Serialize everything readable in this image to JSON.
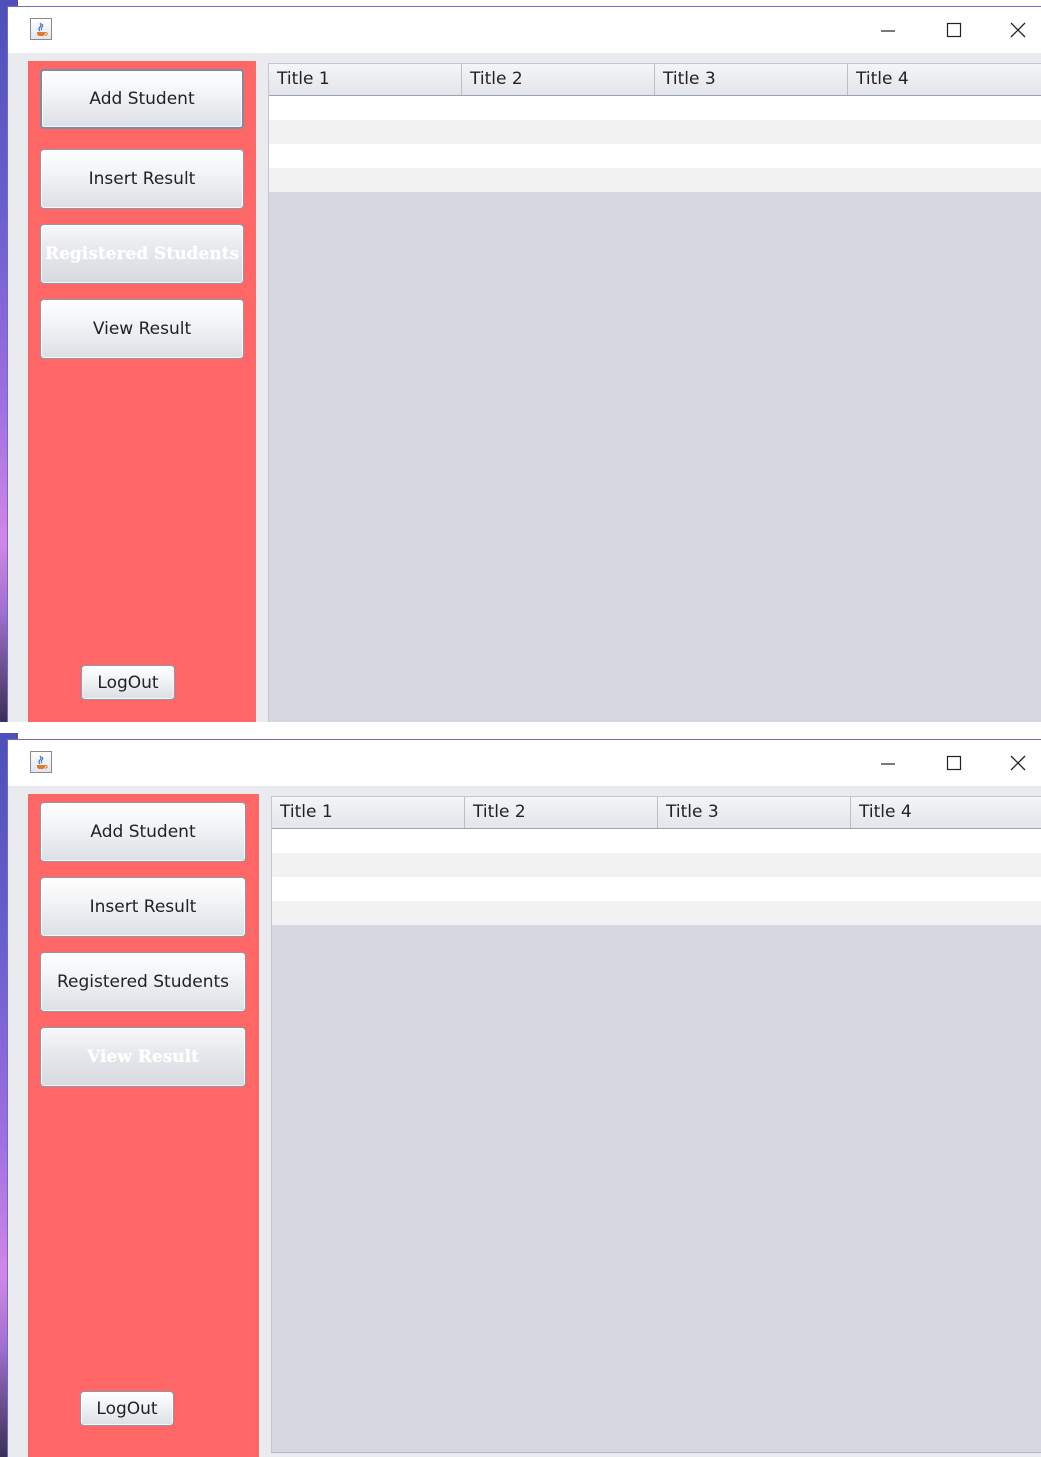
{
  "windows": [
    {
      "sidebar": {
        "buttons": [
          {
            "label": "Add Student",
            "state": "focused"
          },
          {
            "label": "Insert Result",
            "state": "normal"
          },
          {
            "label": "Registered Students",
            "state": "disabled"
          },
          {
            "label": "View Result",
            "state": "normal"
          }
        ],
        "logout_label": "LogOut"
      },
      "table": {
        "columns": [
          "Title 1",
          "Title 2",
          "Title 3",
          "Title 4"
        ],
        "rows": [
          [
            "",
            "",
            "",
            ""
          ],
          [
            "",
            "",
            "",
            ""
          ],
          [
            "",
            "",
            "",
            ""
          ],
          [
            "",
            "",
            "",
            ""
          ]
        ]
      }
    },
    {
      "sidebar": {
        "buttons": [
          {
            "label": "Add Student",
            "state": "normal"
          },
          {
            "label": "Insert Result",
            "state": "normal"
          },
          {
            "label": "Registered Students",
            "state": "normal"
          },
          {
            "label": "View Result",
            "state": "disabled"
          }
        ],
        "logout_label": "LogOut"
      },
      "table": {
        "columns": [
          "Title 1",
          "Title 2",
          "Title 3",
          "Title 4"
        ],
        "rows": [
          [
            "",
            "",
            "",
            ""
          ],
          [
            "",
            "",
            "",
            ""
          ],
          [
            "",
            "",
            "",
            ""
          ],
          [
            "",
            "",
            "",
            ""
          ]
        ]
      }
    }
  ],
  "colors": {
    "sidebar": "#ff6666",
    "table_background": "#d5d8e0",
    "window_frame": "#6d6ac9"
  },
  "icons": {
    "app": "java-cup-icon",
    "minimize": "minimize-icon",
    "maximize": "maximize-icon",
    "close": "close-icon"
  }
}
